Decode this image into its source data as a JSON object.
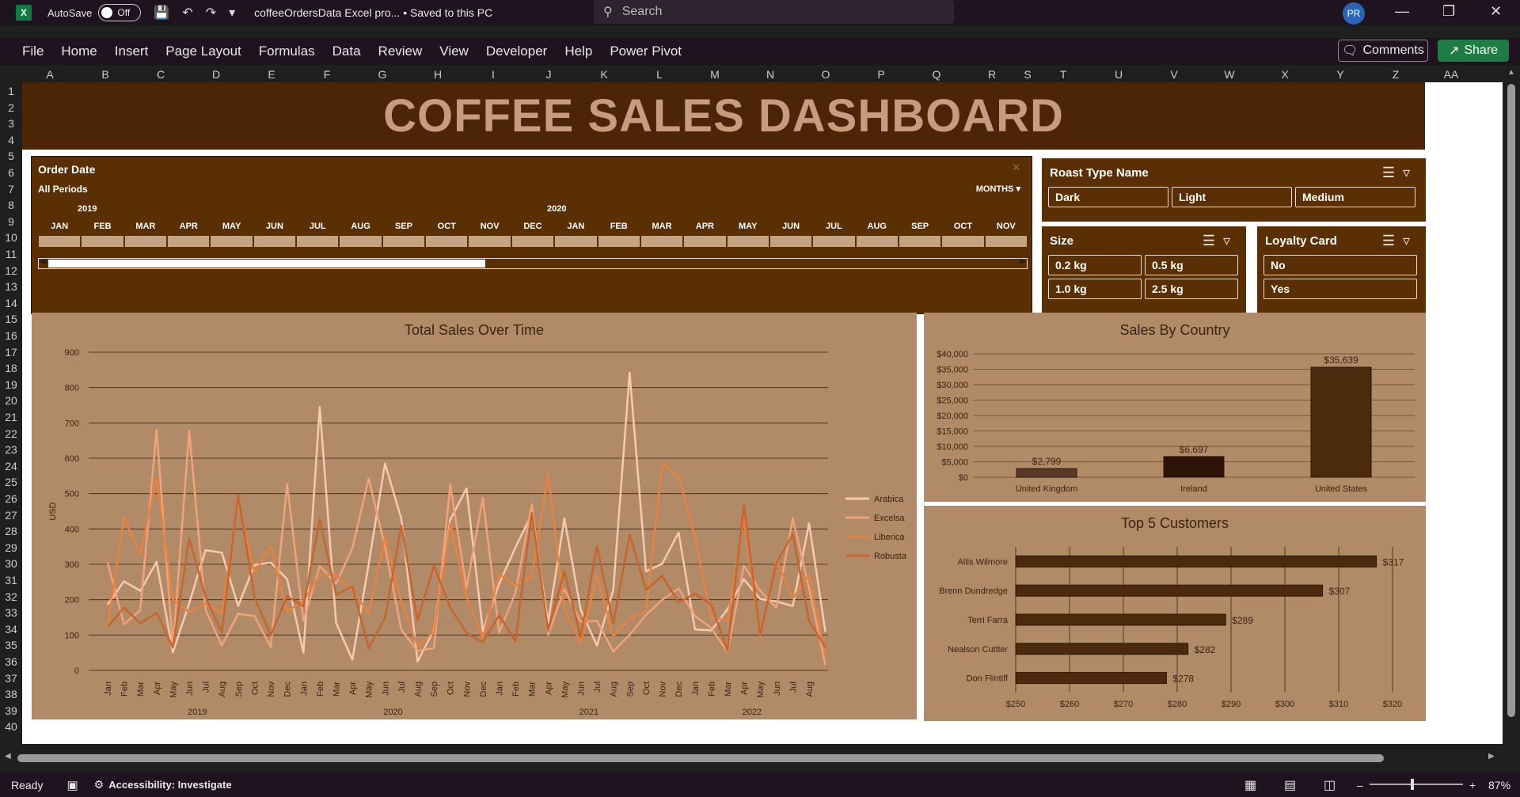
{
  "titlebar": {
    "app_icon": "X",
    "autosave_label": "AutoSave",
    "autosave_state": "Off",
    "doc_title": "coffeeOrdersData Excel pro... • Saved to this PC",
    "search_placeholder": "Search",
    "user_initials": "PR"
  },
  "ribbon": {
    "tabs": [
      "File",
      "Home",
      "Insert",
      "Page Layout",
      "Formulas",
      "Data",
      "Review",
      "View",
      "Developer",
      "Help",
      "Power Pivot"
    ],
    "comments_label": "Comments",
    "share_label": "Share"
  },
  "columns": [
    "A",
    "B",
    "C",
    "D",
    "E",
    "F",
    "G",
    "H",
    "I",
    "J",
    "K",
    "L",
    "M",
    "N",
    "O",
    "P",
    "Q",
    "R",
    "S",
    "T",
    "U",
    "V",
    "W",
    "X",
    "Y",
    "Z",
    "AA"
  ],
  "rows": [
    "1",
    "2",
    "3",
    "4",
    "5",
    "6",
    "7",
    "8",
    "9",
    "10",
    "11",
    "12",
    "13",
    "14",
    "15",
    "16",
    "17",
    "18",
    "19",
    "20",
    "21",
    "22",
    "23",
    "24",
    "25",
    "26",
    "27",
    "28",
    "29",
    "30",
    "31",
    "32",
    "33",
    "34",
    "35",
    "36",
    "37",
    "38",
    "39",
    "40"
  ],
  "dashboard": {
    "title": "COFFEE SALES DASHBOARD"
  },
  "timeline": {
    "title": "Order Date",
    "period": "All Periods",
    "level": "MONTHS",
    "years": [
      "2019",
      "2020"
    ],
    "months": [
      "JAN",
      "FEB",
      "MAR",
      "APR",
      "MAY",
      "JUN",
      "JUL",
      "AUG",
      "SEP",
      "OCT",
      "NOV",
      "DEC",
      "JAN",
      "FEB",
      "MAR",
      "APR",
      "MAY",
      "JUN",
      "JUL",
      "AUG",
      "SEP",
      "OCT",
      "NOV"
    ],
    "scroll_position": 0.45
  },
  "slicers": {
    "roast": {
      "title": "Roast Type Name",
      "items": [
        "Dark",
        "Light",
        "Medium"
      ]
    },
    "size": {
      "title": "Size",
      "items": [
        "0.2 kg",
        "0.5 kg",
        "1.0 kg",
        "2.5 kg"
      ]
    },
    "loyalty": {
      "title": "Loyalty Card",
      "items": [
        "No",
        "Yes"
      ]
    }
  },
  "colors": {
    "banner": "#4b2505",
    "slicer_bg": "#5a2f03",
    "panel_bg": "#b18a67",
    "bar": "#4b2a0e",
    "arabica": "#f8c9b0",
    "excelsa": "#f2a27a",
    "liberica": "#e8823f",
    "robusta": "#c7652c"
  },
  "chart_data": [
    {
      "type": "line",
      "title": "Total Sales Over Time",
      "ylabel": "USD",
      "ylim": [
        0,
        900
      ],
      "yticks": [
        0,
        100,
        200,
        300,
        400,
        500,
        600,
        700,
        800,
        900
      ],
      "x": [
        "Jan",
        "Feb",
        "Mar",
        "Apr",
        "May",
        "Jun",
        "Jul",
        "Aug",
        "Sep",
        "Oct",
        "Nov",
        "Dec",
        "Jan",
        "Feb",
        "Mar",
        "Apr",
        "May",
        "Jun",
        "Jul",
        "Aug",
        "Sep",
        "Oct",
        "Nov",
        "Dec",
        "Jan",
        "Feb",
        "Mar",
        "Apr",
        "May",
        "Jun",
        "Jul",
        "Aug",
        "Sep",
        "Oct",
        "Nov",
        "Dec",
        "Jan",
        "Feb",
        "Mar",
        "Apr",
        "May",
        "Jun",
        "Jul",
        "Aug"
      ],
      "year_labels": [
        "2019",
        "2020",
        "2021",
        "2022"
      ],
      "legend_position": "right",
      "series": [
        {
          "name": "Arabica",
          "values": [
            186,
            252,
            225,
            307,
            51,
            190,
            340,
            333,
            182,
            298,
            305,
            258,
            50,
            745,
            135,
            30,
            300,
            585,
            429,
            25,
            114,
            426,
            515,
            111,
            245,
            348,
            442,
            135,
            430,
            171,
            70,
            228,
            842,
            280,
            302,
            390,
            116,
            113,
            173,
            258,
            202,
            195,
            182,
            416,
            109
          ]
        },
        {
          "name": "Excelsa",
          "values": [
            305,
            130,
            170,
            680,
            65,
            677,
            171,
            70,
            160,
            154,
            66,
            528,
            140,
            295,
            245,
            345,
            543,
            350,
            115,
            55,
            63,
            525,
            233,
            488,
            107,
            219,
            470,
            101,
            230,
            137,
            140,
            53,
            100,
            157,
            200,
            232,
            154,
            120,
            52,
            296,
            225,
            177,
            430,
            232,
            15
          ]
        },
        {
          "name": "Liberica",
          "values": [
            128,
            432,
            327,
            544,
            200,
            165,
            190,
            162,
            480,
            276,
            352,
            167,
            197,
            270,
            270,
            227,
            162,
            376,
            194,
            68,
            110,
            415,
            207,
            91,
            272,
            240,
            265,
            554,
            169,
            79,
            267,
            96,
            145,
            166,
            586,
            548,
            378,
            148,
            142,
            430,
            95,
            311,
            204,
            270,
            38
          ]
        },
        {
          "name": "Robusta",
          "values": [
            123,
            178,
            133,
            163,
            65,
            373,
            208,
            107,
            496,
            208,
            99,
            210,
            181,
            426,
            214,
            238,
            62,
            148,
            409,
            142,
            296,
            178,
            106,
            80,
            156,
            83,
            445,
            112,
            281,
            94,
            352,
            132,
            384,
            228,
            267,
            192,
            217,
            186,
            55,
            468,
            100,
            304,
            385,
            140,
            65
          ]
        }
      ]
    },
    {
      "type": "bar",
      "title": "Sales By Country",
      "categories": [
        "United Kingdom",
        "Ireland",
        "United States"
      ],
      "values": [
        2799,
        6697,
        35639
      ],
      "data_labels": [
        "$2,799",
        "$6,697",
        "$35,639"
      ],
      "ylim": [
        0,
        40000
      ],
      "yticks": [
        "$0",
        "$5,000",
        "$10,000",
        "$15,000",
        "$20,000",
        "$25,000",
        "$30,000",
        "$35,000",
        "$40,000"
      ]
    },
    {
      "type": "bar",
      "orientation": "horizontal",
      "title": "Top 5 Customers",
      "categories": [
        "Allis Wilmore",
        "Brenn Dundredge",
        "Terri Farra",
        "Nealson Cuttler",
        "Don Flintiff"
      ],
      "values": [
        317,
        307,
        289,
        282,
        278
      ],
      "data_labels": [
        "$317",
        "$307",
        "$289",
        "$282",
        "$278"
      ],
      "xlim": [
        250,
        320
      ],
      "xticks": [
        "$250",
        "$260",
        "$270",
        "$280",
        "$290",
        "$300",
        "$310",
        "$320"
      ]
    }
  ],
  "statusbar": {
    "ready": "Ready",
    "accessibility": "Accessibility: Investigate",
    "zoom": "87%"
  }
}
